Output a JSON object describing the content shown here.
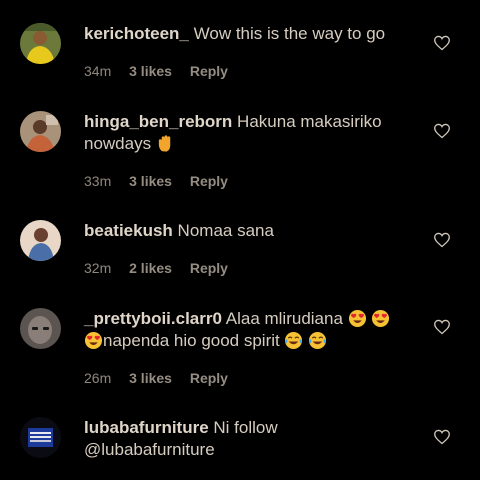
{
  "comments": [
    {
      "username": "kerichoteen_",
      "text": "Wow this is the way to go",
      "time": "34m",
      "likes": "3 likes",
      "reply": "Reply"
    },
    {
      "username": "hinga_ben_reborn",
      "text_line1": "Hakuna makasiriko",
      "text_line2": "nowdays",
      "time": "33m",
      "likes": "3 likes",
      "reply": "Reply"
    },
    {
      "username": "beatiekush",
      "text": "Nomaa sana",
      "time": "32m",
      "likes": "2 likes",
      "reply": "Reply"
    },
    {
      "username": "_prettyboii.clarr0",
      "text_line1": "Alaa mlirudiana",
      "text_line2": "napenda hio good spirit",
      "time": "26m",
      "likes": "3 likes",
      "reply": "Reply"
    },
    {
      "username": "lubabafurniture",
      "text_line1": "Ni follow",
      "text_line2": "@lubabafurniture"
    }
  ],
  "icons": {
    "like": "heart-outline-icon",
    "wave": "waving-hand-emoji",
    "heart_eyes": "heart-eyes-emoji",
    "laughing": "tears-of-joy-emoji"
  },
  "colors": {
    "background": "#000000",
    "text": "#d6ccc0",
    "meta": "#8f877d"
  }
}
